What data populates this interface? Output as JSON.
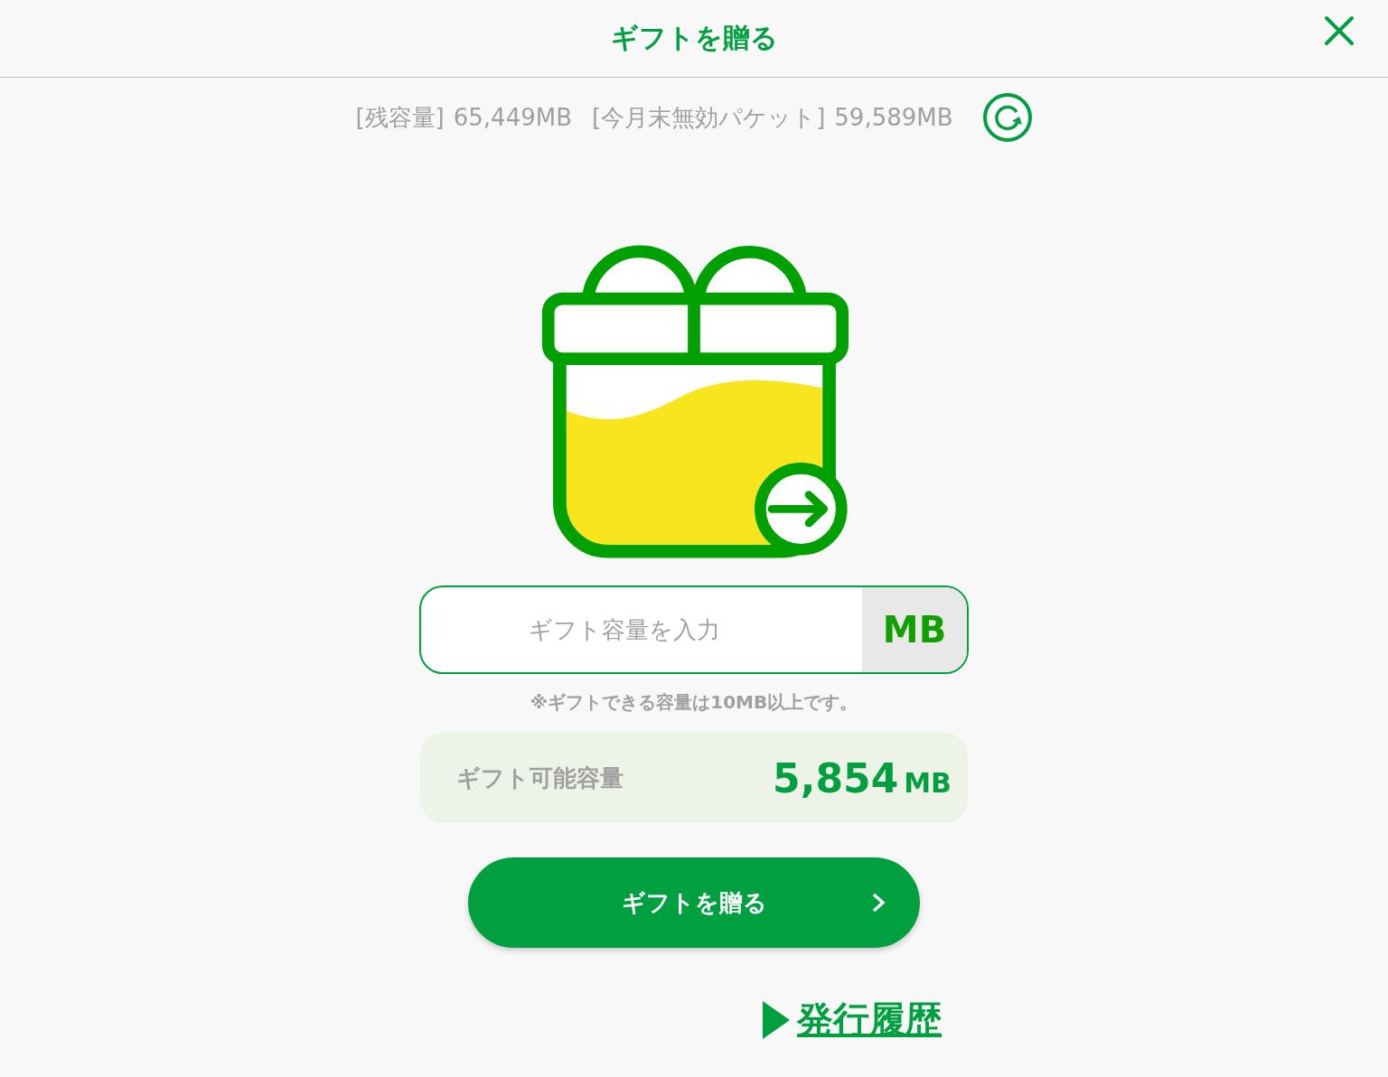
{
  "header": {
    "title": "ギフトを贈る"
  },
  "balance": {
    "remaining_label": "[残容量]",
    "remaining": "65,449MB",
    "expiring_label": "[今月末無効パケット]",
    "expiring": "59,589MB"
  },
  "gift_input": {
    "placeholder": "ギフト容量を入力",
    "unit": "MB",
    "note": "※ギフトできる容量は10MB以上です。"
  },
  "available": {
    "label": "ギフト可能容量",
    "value": "5,854",
    "unit": "MB"
  },
  "submit": {
    "label": "ギフトを贈る"
  },
  "history_link": {
    "label": "発行履歴"
  }
}
